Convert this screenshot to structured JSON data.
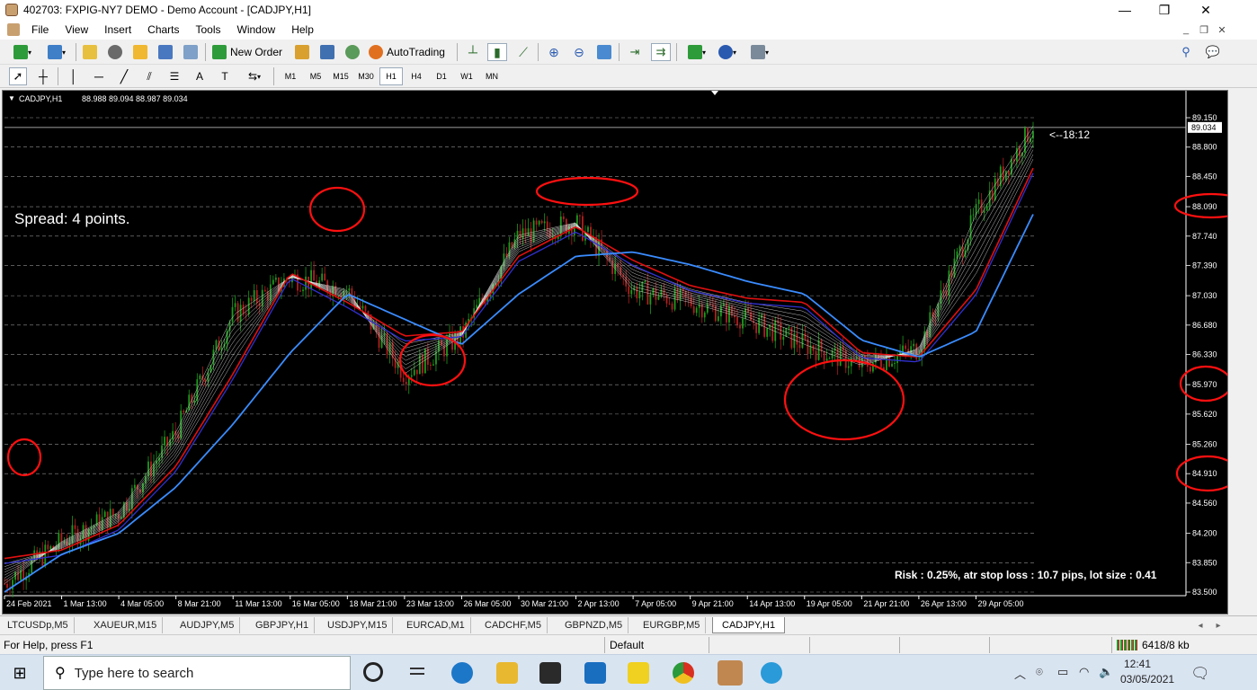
{
  "window": {
    "title": "402703: FXPIG-NY7 DEMO - Demo Account - [CADJPY,H1]",
    "minimize": "—",
    "restore": "❐",
    "close": "✕"
  },
  "menu": {
    "items": [
      "File",
      "View",
      "Insert",
      "Charts",
      "Tools",
      "Window",
      "Help"
    ]
  },
  "toolbar": {
    "new_order": "New Order",
    "autotrading": "AutoTrading"
  },
  "timeframes": [
    "M1",
    "M5",
    "M15",
    "M30",
    "H1",
    "H4",
    "D1",
    "W1",
    "MN"
  ],
  "active_timeframe": "H1",
  "chart": {
    "header": "CADJPY,H1",
    "ohlc": "88.988 89.094 88.987 89.034",
    "spread": "Spread: 4 points.",
    "countdown": "<--18:12",
    "risk": "Risk : 0.25%, atr stop loss : 10.7 pips, lot size : 0.41",
    "price_labels": [
      "89.150",
      "89.034",
      "88.800",
      "88.450",
      "88.090",
      "87.740",
      "87.390",
      "87.030",
      "86.680",
      "86.330",
      "85.970",
      "85.620",
      "85.260",
      "84.910",
      "84.560",
      "84.200",
      "83.850",
      "83.500"
    ],
    "time_labels": [
      "24 Feb 2021",
      "1 Mar 13:00",
      "4 Mar 05:00",
      "8 Mar 21:00",
      "11 Mar 13:00",
      "16 Mar 05:00",
      "18 Mar 21:00",
      "23 Mar 13:00",
      "26 Mar 05:00",
      "30 Mar 21:00",
      "2 Apr 13:00",
      "7 Apr 05:00",
      "9 Apr 21:00",
      "14 Apr 13:00",
      "19 Apr 05:00",
      "21 Apr 21:00",
      "26 Apr 13:00",
      "29 Apr 05:00"
    ],
    "colors": {
      "bull": "#1f9a1f",
      "bear": "#b02020",
      "ema_red": "#e01010",
      "ema_blue": "#3a8cff",
      "ribbon": "#ffffff",
      "annot": "#ff1010",
      "grid": "#909090"
    }
  },
  "chart_data": {
    "type": "line",
    "symbol": "CADJPY",
    "timeframe": "H1",
    "ylim": [
      83.5,
      89.15
    ],
    "current_price": 89.034,
    "x": [
      "24 Feb 2021",
      "1 Mar 13:00",
      "4 Mar 05:00",
      "8 Mar 21:00",
      "11 Mar 13:00",
      "16 Mar 05:00",
      "18 Mar 21:00",
      "23 Mar 13:00",
      "26 Mar 05:00",
      "30 Mar 21:00",
      "2 Apr 13:00",
      "7 Apr 05:00",
      "9 Apr 21:00",
      "14 Apr 13:00",
      "19 Apr 05:00",
      "21 Apr 21:00",
      "26 Apr 13:00",
      "29 Apr 05:00",
      "29 Apr 05:00+"
    ],
    "series": [
      {
        "values": [
          83.6,
          84.1,
          84.45,
          85.4,
          86.8,
          87.25,
          87.1,
          86.1,
          86.55,
          87.75,
          87.9,
          87.1,
          86.95,
          86.75,
          86.45,
          86.2,
          86.4,
          88.0,
          89.05
        ]
      },
      {
        "values": [
          83.9,
          84.0,
          84.3,
          85.0,
          86.1,
          87.3,
          86.95,
          86.55,
          86.6,
          87.5,
          87.85,
          87.45,
          87.15,
          87.0,
          86.95,
          86.35,
          86.3,
          87.1,
          88.55
        ]
      },
      {
        "values": [
          83.5,
          83.95,
          84.2,
          84.75,
          85.5,
          86.35,
          87.05,
          86.75,
          86.45,
          87.05,
          87.5,
          87.55,
          87.4,
          87.2,
          87.05,
          86.5,
          86.3,
          86.6,
          88.0
        ]
      }
    ]
  },
  "tabs": [
    "LTCUSDp,M5",
    "XAUEUR,M15",
    "AUDJPY,M5",
    "GBPJPY,H1",
    "USDJPY,M15",
    "EURCAD,M1",
    "CADCHF,M5",
    "GBPNZD,M5",
    "EURGBP,M5",
    "CADJPY,H1"
  ],
  "status": {
    "help": "For Help, press F1",
    "profile": "Default",
    "traffic": "6418/8 kb"
  },
  "taskbar": {
    "search_placeholder": "Type here to search",
    "time": "12:41",
    "date": "03/05/2021"
  }
}
